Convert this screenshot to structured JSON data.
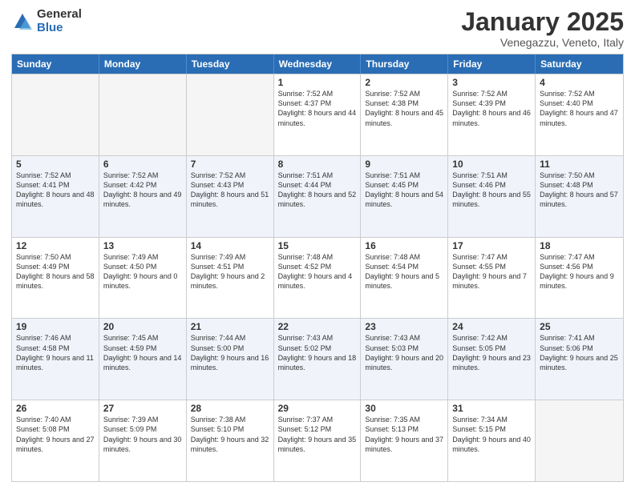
{
  "header": {
    "logo_general": "General",
    "logo_blue": "Blue",
    "title": "January 2025",
    "subtitle": "Venegazzu, Veneto, Italy"
  },
  "day_headers": [
    "Sunday",
    "Monday",
    "Tuesday",
    "Wednesday",
    "Thursday",
    "Friday",
    "Saturday"
  ],
  "weeks": [
    [
      {
        "day": "",
        "info": ""
      },
      {
        "day": "",
        "info": ""
      },
      {
        "day": "",
        "info": ""
      },
      {
        "day": "1",
        "info": "Sunrise: 7:52 AM\nSunset: 4:37 PM\nDaylight: 8 hours\nand 44 minutes."
      },
      {
        "day": "2",
        "info": "Sunrise: 7:52 AM\nSunset: 4:38 PM\nDaylight: 8 hours\nand 45 minutes."
      },
      {
        "day": "3",
        "info": "Sunrise: 7:52 AM\nSunset: 4:39 PM\nDaylight: 8 hours\nand 46 minutes."
      },
      {
        "day": "4",
        "info": "Sunrise: 7:52 AM\nSunset: 4:40 PM\nDaylight: 8 hours\nand 47 minutes."
      }
    ],
    [
      {
        "day": "5",
        "info": "Sunrise: 7:52 AM\nSunset: 4:41 PM\nDaylight: 8 hours\nand 48 minutes."
      },
      {
        "day": "6",
        "info": "Sunrise: 7:52 AM\nSunset: 4:42 PM\nDaylight: 8 hours\nand 49 minutes."
      },
      {
        "day": "7",
        "info": "Sunrise: 7:52 AM\nSunset: 4:43 PM\nDaylight: 8 hours\nand 51 minutes."
      },
      {
        "day": "8",
        "info": "Sunrise: 7:51 AM\nSunset: 4:44 PM\nDaylight: 8 hours\nand 52 minutes."
      },
      {
        "day": "9",
        "info": "Sunrise: 7:51 AM\nSunset: 4:45 PM\nDaylight: 8 hours\nand 54 minutes."
      },
      {
        "day": "10",
        "info": "Sunrise: 7:51 AM\nSunset: 4:46 PM\nDaylight: 8 hours\nand 55 minutes."
      },
      {
        "day": "11",
        "info": "Sunrise: 7:50 AM\nSunset: 4:48 PM\nDaylight: 8 hours\nand 57 minutes."
      }
    ],
    [
      {
        "day": "12",
        "info": "Sunrise: 7:50 AM\nSunset: 4:49 PM\nDaylight: 8 hours\nand 58 minutes."
      },
      {
        "day": "13",
        "info": "Sunrise: 7:49 AM\nSunset: 4:50 PM\nDaylight: 9 hours\nand 0 minutes."
      },
      {
        "day": "14",
        "info": "Sunrise: 7:49 AM\nSunset: 4:51 PM\nDaylight: 9 hours\nand 2 minutes."
      },
      {
        "day": "15",
        "info": "Sunrise: 7:48 AM\nSunset: 4:52 PM\nDaylight: 9 hours\nand 4 minutes."
      },
      {
        "day": "16",
        "info": "Sunrise: 7:48 AM\nSunset: 4:54 PM\nDaylight: 9 hours\nand 5 minutes."
      },
      {
        "day": "17",
        "info": "Sunrise: 7:47 AM\nSunset: 4:55 PM\nDaylight: 9 hours\nand 7 minutes."
      },
      {
        "day": "18",
        "info": "Sunrise: 7:47 AM\nSunset: 4:56 PM\nDaylight: 9 hours\nand 9 minutes."
      }
    ],
    [
      {
        "day": "19",
        "info": "Sunrise: 7:46 AM\nSunset: 4:58 PM\nDaylight: 9 hours\nand 11 minutes."
      },
      {
        "day": "20",
        "info": "Sunrise: 7:45 AM\nSunset: 4:59 PM\nDaylight: 9 hours\nand 14 minutes."
      },
      {
        "day": "21",
        "info": "Sunrise: 7:44 AM\nSunset: 5:00 PM\nDaylight: 9 hours\nand 16 minutes."
      },
      {
        "day": "22",
        "info": "Sunrise: 7:43 AM\nSunset: 5:02 PM\nDaylight: 9 hours\nand 18 minutes."
      },
      {
        "day": "23",
        "info": "Sunrise: 7:43 AM\nSunset: 5:03 PM\nDaylight: 9 hours\nand 20 minutes."
      },
      {
        "day": "24",
        "info": "Sunrise: 7:42 AM\nSunset: 5:05 PM\nDaylight: 9 hours\nand 23 minutes."
      },
      {
        "day": "25",
        "info": "Sunrise: 7:41 AM\nSunset: 5:06 PM\nDaylight: 9 hours\nand 25 minutes."
      }
    ],
    [
      {
        "day": "26",
        "info": "Sunrise: 7:40 AM\nSunset: 5:08 PM\nDaylight: 9 hours\nand 27 minutes."
      },
      {
        "day": "27",
        "info": "Sunrise: 7:39 AM\nSunset: 5:09 PM\nDaylight: 9 hours\nand 30 minutes."
      },
      {
        "day": "28",
        "info": "Sunrise: 7:38 AM\nSunset: 5:10 PM\nDaylight: 9 hours\nand 32 minutes."
      },
      {
        "day": "29",
        "info": "Sunrise: 7:37 AM\nSunset: 5:12 PM\nDaylight: 9 hours\nand 35 minutes."
      },
      {
        "day": "30",
        "info": "Sunrise: 7:35 AM\nSunset: 5:13 PM\nDaylight: 9 hours\nand 37 minutes."
      },
      {
        "day": "31",
        "info": "Sunrise: 7:34 AM\nSunset: 5:15 PM\nDaylight: 9 hours\nand 40 minutes."
      },
      {
        "day": "",
        "info": ""
      }
    ]
  ]
}
